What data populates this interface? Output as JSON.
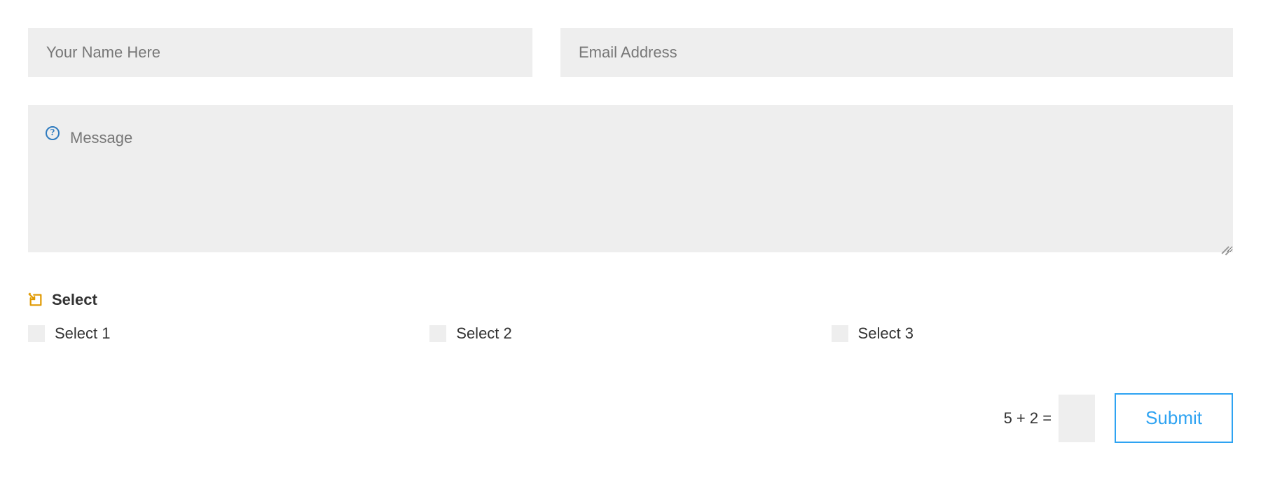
{
  "form": {
    "name_placeholder": "Your Name Here",
    "email_placeholder": "Email Address",
    "message_placeholder": "Message",
    "select_title": "Select",
    "options": [
      {
        "label": "Select 1"
      },
      {
        "label": "Select 2"
      },
      {
        "label": "Select 3"
      }
    ],
    "captcha_question": "5 + 2 =",
    "submit_label": "Submit",
    "help_icon_glyph": "?"
  },
  "colors": {
    "accent": "#2ea3f2",
    "icon_gold": "#e09900",
    "field_bg": "#eeeeee"
  }
}
